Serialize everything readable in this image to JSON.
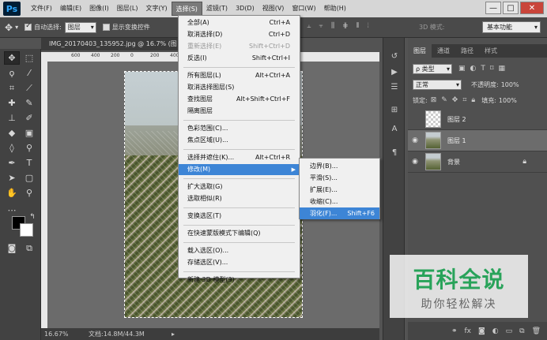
{
  "app": {
    "logo": "Ps"
  },
  "menubar": {
    "items": [
      "文件(F)",
      "编辑(E)",
      "图像(I)",
      "图层(L)",
      "文字(Y)",
      "选择(S)",
      "滤镜(T)",
      "3D(D)",
      "视图(V)",
      "窗口(W)",
      "帮助(H)"
    ],
    "active_index": 5,
    "win_min": "—",
    "win_max": "□",
    "win_close": "✕"
  },
  "options": {
    "auto_select_label": "自动选择:",
    "auto_select_target": "图层",
    "show_transform_label": "显示变换控件",
    "mode_3d": "3D 模式:",
    "workspace": "基本功能"
  },
  "document": {
    "tab_title": "IMG_20170403_135952.jpg @ 16.7% (图层",
    "ruler_ticks": [
      "600",
      "400",
      "200",
      "0",
      "200",
      "400"
    ],
    "zoom": "16.67%",
    "doc_size": "文档:14.8M/44.3M"
  },
  "select_menu": {
    "items": [
      {
        "label": "全部(A)",
        "shortcut": "Ctrl+A",
        "disabled": false
      },
      {
        "label": "取消选择(D)",
        "shortcut": "Ctrl+D",
        "disabled": false
      },
      {
        "label": "重新选择(E)",
        "shortcut": "Shift+Ctrl+D",
        "disabled": true
      },
      {
        "label": "反选(I)",
        "shortcut": "Shift+Ctrl+I",
        "disabled": false
      },
      {
        "label": "所有图层(L)",
        "shortcut": "Alt+Ctrl+A",
        "disabled": false
      },
      {
        "label": "取消选择图层(S)",
        "shortcut": "",
        "disabled": false
      },
      {
        "label": "查找图层",
        "shortcut": "Alt+Shift+Ctrl+F",
        "disabled": false
      },
      {
        "label": "隔离图层",
        "shortcut": "",
        "disabled": false
      },
      {
        "label": "色彩范围(C)...",
        "shortcut": "",
        "disabled": false
      },
      {
        "label": "焦点区域(U)...",
        "shortcut": "",
        "disabled": false
      },
      {
        "label": "选择并遮住(K)...",
        "shortcut": "Alt+Ctrl+R",
        "disabled": false
      },
      {
        "label": "修改(M)",
        "shortcut": "",
        "disabled": false,
        "highlight": true,
        "submenu": true
      },
      {
        "label": "扩大选取(G)",
        "shortcut": "",
        "disabled": false
      },
      {
        "label": "选取相似(R)",
        "shortcut": "",
        "disabled": false
      },
      {
        "label": "变换选区(T)",
        "shortcut": "",
        "disabled": false
      },
      {
        "label": "在快速蒙版模式下编辑(Q)",
        "shortcut": "",
        "disabled": false
      },
      {
        "label": "载入选区(O)...",
        "shortcut": "",
        "disabled": false
      },
      {
        "label": "存储选区(V)...",
        "shortcut": "",
        "disabled": false
      },
      {
        "label": "新建 3D 模型(3)",
        "shortcut": "",
        "disabled": false
      }
    ]
  },
  "modify_submenu": {
    "items": [
      {
        "label": "边界(B)...",
        "shortcut": ""
      },
      {
        "label": "平滑(S)...",
        "shortcut": ""
      },
      {
        "label": "扩展(E)...",
        "shortcut": ""
      },
      {
        "label": "收缩(C)...",
        "shortcut": ""
      },
      {
        "label": "羽化(F)...",
        "shortcut": "Shift+F6",
        "highlight": true
      }
    ]
  },
  "layers_panel": {
    "tabs": [
      "图层",
      "通道",
      "路径",
      "样式"
    ],
    "filter_kind": "ρ 类型",
    "blend_mode": "正常",
    "opacity_label": "不透明度:",
    "opacity_value": "100%",
    "lock_label": "锁定:",
    "fill_label": "填充:",
    "fill_value": "100%",
    "layers": [
      {
        "name": "图层 2",
        "visible": false,
        "selected": false,
        "thumb": "empty"
      },
      {
        "name": "图层 1",
        "visible": true,
        "selected": true,
        "thumb": "photo"
      },
      {
        "name": "背景",
        "visible": true,
        "selected": false,
        "thumb": "photo",
        "locked": true
      }
    ]
  },
  "watermark": {
    "title": "百科全说",
    "subtitle": "助你轻松解决"
  }
}
